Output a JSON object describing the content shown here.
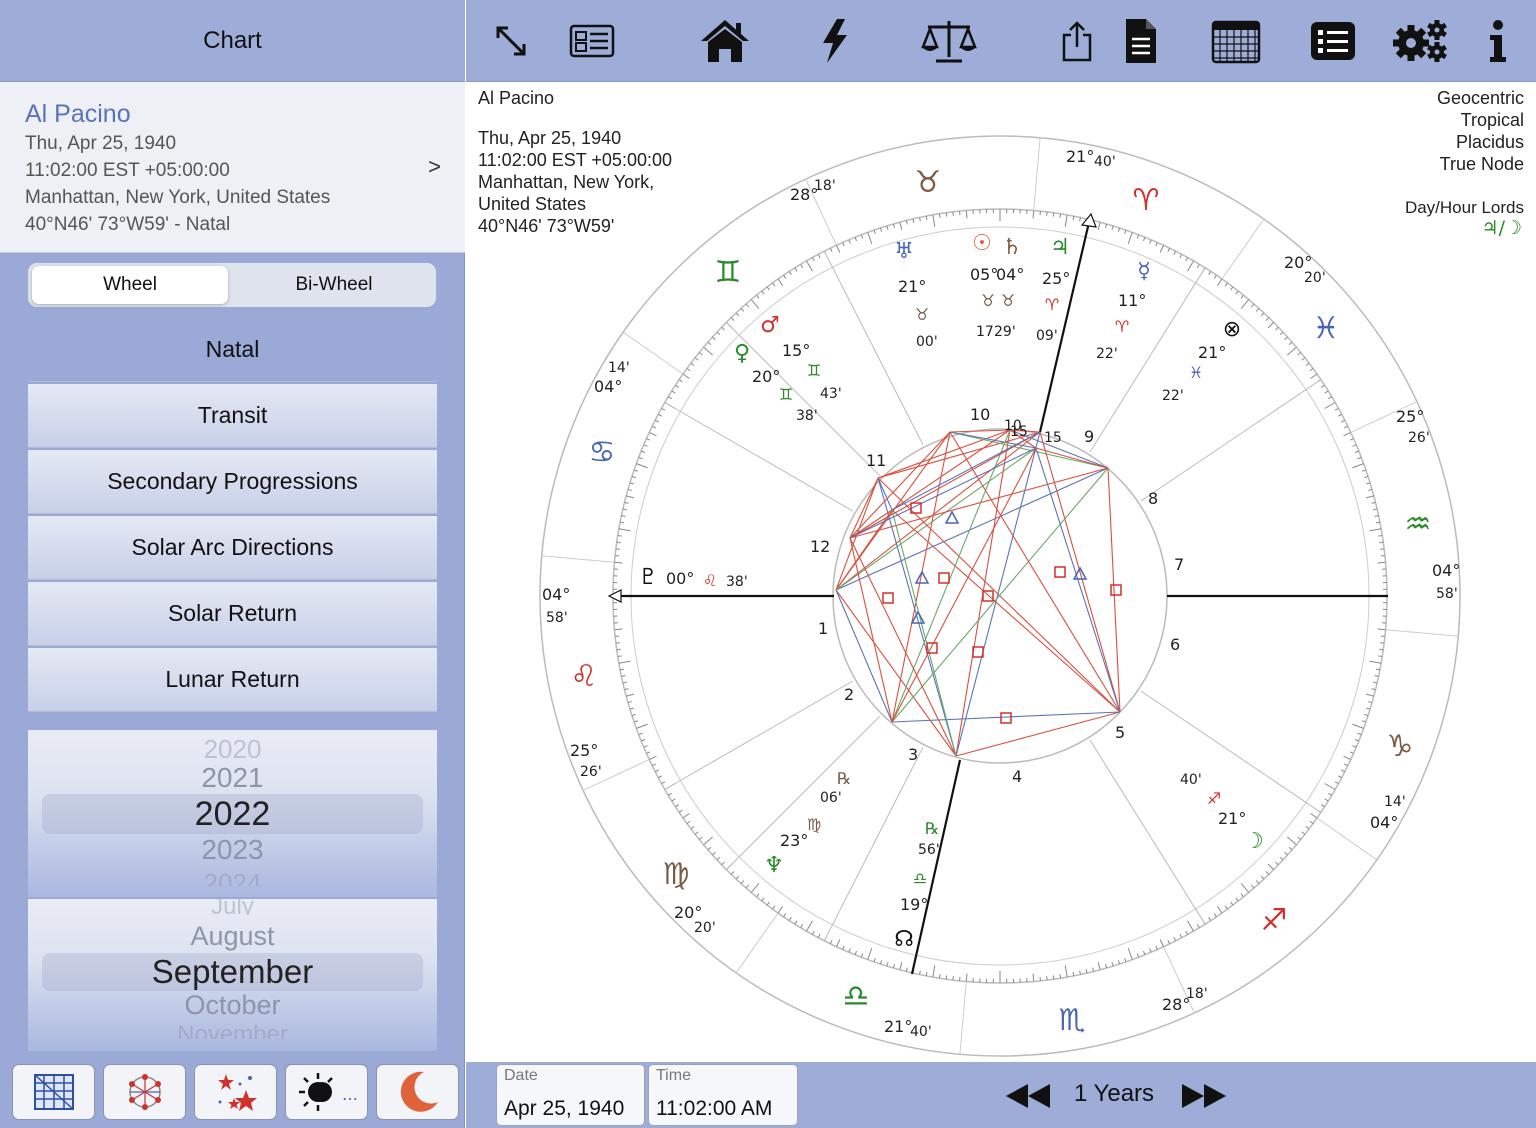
{
  "sidebar": {
    "title": "Chart",
    "person": {
      "name": "Al Pacino",
      "date": "Thu, Apr 25, 1940",
      "time": "11:02:00 EST +05:00:00",
      "place": "Manhattan, New York, United States",
      "coords": "40°N46' 73°W59' - Natal",
      "chevron": ">"
    },
    "segment": {
      "active": "Wheel",
      "inactive": "Bi-Wheel"
    },
    "chart_types": [
      "Natal",
      "Transit",
      "Secondary Progressions",
      "Solar Arc Directions",
      "Solar Return",
      "Lunar Return"
    ],
    "year_picker": {
      "above2": "2020",
      "above": "2021",
      "current": "2022",
      "below": "2023",
      "below2": "2024"
    },
    "month_picker": {
      "above2": "July",
      "above": "August",
      "current": "September",
      "below": "October",
      "below2": "November"
    }
  },
  "top_icons": [
    "expand-icon",
    "id-card-icon",
    "home-icon",
    "lightning-icon",
    "scales-icon",
    "share-icon",
    "document-icon",
    "calendar-grid-icon",
    "list-icon",
    "gears-icon",
    "info-icon"
  ],
  "chart_header": {
    "name": "Al Pacino",
    "date": "Thu, Apr 25, 1940",
    "time": "11:02:00 EST +05:00:00",
    "place1": "Manhattan, New York,",
    "place2": "United States",
    "coords": "40°N46' 73°W59'",
    "system1": "Geocentric",
    "system2": "Tropical",
    "system3": "Placidus",
    "system4": "True Node",
    "lords_label": "Day/Hour Lords",
    "lords_value": "♃/☽"
  },
  "wheel": {
    "cusps": [
      {
        "deg": "21°",
        "min": "40'"
      },
      {
        "deg": "28°",
        "min": "18'"
      },
      {
        "deg": "14'",
        "min": "04°"
      },
      {
        "deg": "04°",
        "min": "58'"
      },
      {
        "deg": "25°",
        "min": "26'"
      },
      {
        "deg": "20°",
        "min": "20'"
      },
      {
        "deg": "21°",
        "min": "40'"
      },
      {
        "deg": "28°",
        "min": "18'"
      },
      {
        "deg": "14'",
        "min": "04°"
      },
      {
        "deg": "04°",
        "min": "58'"
      },
      {
        "deg": "25°",
        "min": "26'"
      },
      {
        "deg": "20°",
        "min": "20'"
      }
    ],
    "houses": [
      "1",
      "2",
      "3",
      "4",
      "5",
      "6",
      "7",
      "8",
      "9",
      "10",
      "11",
      "12"
    ],
    "planet_labels": [
      {
        "text": "21°"
      },
      {
        "text": "00'"
      },
      {
        "text": "05°"
      },
      {
        "text": "04°"
      },
      {
        "text": "17"
      },
      {
        "text": "29'"
      },
      {
        "text": "25°"
      },
      {
        "text": "09'"
      },
      {
        "text": "11°"
      },
      {
        "text": "22'"
      },
      {
        "text": "21°"
      },
      {
        "text": "22'"
      },
      {
        "text": "15°"
      },
      {
        "text": "43'"
      },
      {
        "text": "20°"
      },
      {
        "text": "38'"
      },
      {
        "text": "00°"
      },
      {
        "text": "38'"
      },
      {
        "text": "06'"
      },
      {
        "text": "23°"
      },
      {
        "text": "56'"
      },
      {
        "text": "19°"
      },
      {
        "text": "40'"
      },
      {
        "text": "21°"
      }
    ],
    "aspect_inner_labels": [
      "10",
      "15",
      "15",
      "9"
    ]
  },
  "bottom": {
    "date_label": "Date",
    "date_value": "Apr 25, 1940",
    "time_label": "Time",
    "time_value": "11:02:00 AM",
    "step": "1 Years"
  },
  "bottom_tools": [
    "grid-icon",
    "aspect-web-icon",
    "stars-icon",
    "eclipse-icon",
    "moon-icon"
  ],
  "colors": {
    "accent": "#9eadd8",
    "red": "#d0312d",
    "blue": "#4a64b4",
    "green": "#2a8a2a",
    "brown": "#7a5c48"
  }
}
